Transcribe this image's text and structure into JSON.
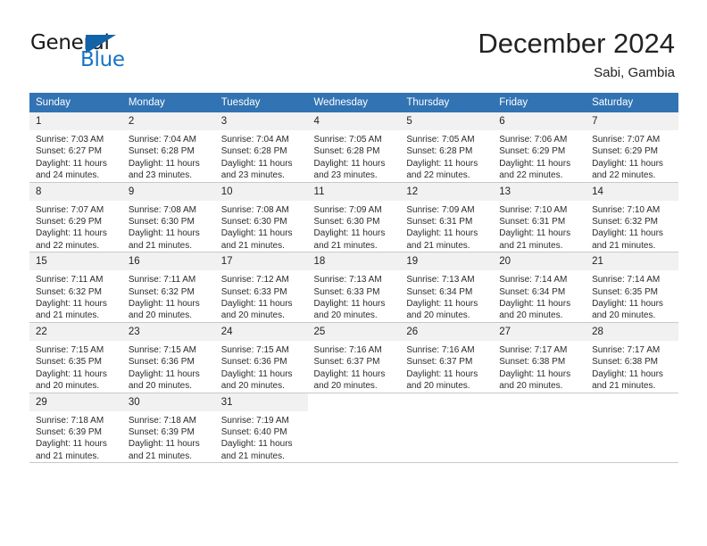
{
  "brand": {
    "name_part1": "General",
    "name_part2": "Blue",
    "triangle_color": "#1263a8",
    "blue_color": "#1673c6"
  },
  "header": {
    "title": "December 2024",
    "subtitle": "Sabi, Gambia",
    "header_bg_color": "#3273b3",
    "daynum_bg_color": "#f1f1f1"
  },
  "weekday_headers": [
    "Sunday",
    "Monday",
    "Tuesday",
    "Wednesday",
    "Thursday",
    "Friday",
    "Saturday"
  ],
  "weeks": [
    {
      "days": [
        {
          "num": "1",
          "sunrise": "Sunrise: 7:03 AM",
          "sunset": "Sunset: 6:27 PM",
          "daylight1": "Daylight: 11 hours",
          "daylight2": "and 24 minutes."
        },
        {
          "num": "2",
          "sunrise": "Sunrise: 7:04 AM",
          "sunset": "Sunset: 6:28 PM",
          "daylight1": "Daylight: 11 hours",
          "daylight2": "and 23 minutes."
        },
        {
          "num": "3",
          "sunrise": "Sunrise: 7:04 AM",
          "sunset": "Sunset: 6:28 PM",
          "daylight1": "Daylight: 11 hours",
          "daylight2": "and 23 minutes."
        },
        {
          "num": "4",
          "sunrise": "Sunrise: 7:05 AM",
          "sunset": "Sunset: 6:28 PM",
          "daylight1": "Daylight: 11 hours",
          "daylight2": "and 23 minutes."
        },
        {
          "num": "5",
          "sunrise": "Sunrise: 7:05 AM",
          "sunset": "Sunset: 6:28 PM",
          "daylight1": "Daylight: 11 hours",
          "daylight2": "and 22 minutes."
        },
        {
          "num": "6",
          "sunrise": "Sunrise: 7:06 AM",
          "sunset": "Sunset: 6:29 PM",
          "daylight1": "Daylight: 11 hours",
          "daylight2": "and 22 minutes."
        },
        {
          "num": "7",
          "sunrise": "Sunrise: 7:07 AM",
          "sunset": "Sunset: 6:29 PM",
          "daylight1": "Daylight: 11 hours",
          "daylight2": "and 22 minutes."
        }
      ]
    },
    {
      "days": [
        {
          "num": "8",
          "sunrise": "Sunrise: 7:07 AM",
          "sunset": "Sunset: 6:29 PM",
          "daylight1": "Daylight: 11 hours",
          "daylight2": "and 22 minutes."
        },
        {
          "num": "9",
          "sunrise": "Sunrise: 7:08 AM",
          "sunset": "Sunset: 6:30 PM",
          "daylight1": "Daylight: 11 hours",
          "daylight2": "and 21 minutes."
        },
        {
          "num": "10",
          "sunrise": "Sunrise: 7:08 AM",
          "sunset": "Sunset: 6:30 PM",
          "daylight1": "Daylight: 11 hours",
          "daylight2": "and 21 minutes."
        },
        {
          "num": "11",
          "sunrise": "Sunrise: 7:09 AM",
          "sunset": "Sunset: 6:30 PM",
          "daylight1": "Daylight: 11 hours",
          "daylight2": "and 21 minutes."
        },
        {
          "num": "12",
          "sunrise": "Sunrise: 7:09 AM",
          "sunset": "Sunset: 6:31 PM",
          "daylight1": "Daylight: 11 hours",
          "daylight2": "and 21 minutes."
        },
        {
          "num": "13",
          "sunrise": "Sunrise: 7:10 AM",
          "sunset": "Sunset: 6:31 PM",
          "daylight1": "Daylight: 11 hours",
          "daylight2": "and 21 minutes."
        },
        {
          "num": "14",
          "sunrise": "Sunrise: 7:10 AM",
          "sunset": "Sunset: 6:32 PM",
          "daylight1": "Daylight: 11 hours",
          "daylight2": "and 21 minutes."
        }
      ]
    },
    {
      "days": [
        {
          "num": "15",
          "sunrise": "Sunrise: 7:11 AM",
          "sunset": "Sunset: 6:32 PM",
          "daylight1": "Daylight: 11 hours",
          "daylight2": "and 21 minutes."
        },
        {
          "num": "16",
          "sunrise": "Sunrise: 7:11 AM",
          "sunset": "Sunset: 6:32 PM",
          "daylight1": "Daylight: 11 hours",
          "daylight2": "and 20 minutes."
        },
        {
          "num": "17",
          "sunrise": "Sunrise: 7:12 AM",
          "sunset": "Sunset: 6:33 PM",
          "daylight1": "Daylight: 11 hours",
          "daylight2": "and 20 minutes."
        },
        {
          "num": "18",
          "sunrise": "Sunrise: 7:13 AM",
          "sunset": "Sunset: 6:33 PM",
          "daylight1": "Daylight: 11 hours",
          "daylight2": "and 20 minutes."
        },
        {
          "num": "19",
          "sunrise": "Sunrise: 7:13 AM",
          "sunset": "Sunset: 6:34 PM",
          "daylight1": "Daylight: 11 hours",
          "daylight2": "and 20 minutes."
        },
        {
          "num": "20",
          "sunrise": "Sunrise: 7:14 AM",
          "sunset": "Sunset: 6:34 PM",
          "daylight1": "Daylight: 11 hours",
          "daylight2": "and 20 minutes."
        },
        {
          "num": "21",
          "sunrise": "Sunrise: 7:14 AM",
          "sunset": "Sunset: 6:35 PM",
          "daylight1": "Daylight: 11 hours",
          "daylight2": "and 20 minutes."
        }
      ]
    },
    {
      "days": [
        {
          "num": "22",
          "sunrise": "Sunrise: 7:15 AM",
          "sunset": "Sunset: 6:35 PM",
          "daylight1": "Daylight: 11 hours",
          "daylight2": "and 20 minutes."
        },
        {
          "num": "23",
          "sunrise": "Sunrise: 7:15 AM",
          "sunset": "Sunset: 6:36 PM",
          "daylight1": "Daylight: 11 hours",
          "daylight2": "and 20 minutes."
        },
        {
          "num": "24",
          "sunrise": "Sunrise: 7:15 AM",
          "sunset": "Sunset: 6:36 PM",
          "daylight1": "Daylight: 11 hours",
          "daylight2": "and 20 minutes."
        },
        {
          "num": "25",
          "sunrise": "Sunrise: 7:16 AM",
          "sunset": "Sunset: 6:37 PM",
          "daylight1": "Daylight: 11 hours",
          "daylight2": "and 20 minutes."
        },
        {
          "num": "26",
          "sunrise": "Sunrise: 7:16 AM",
          "sunset": "Sunset: 6:37 PM",
          "daylight1": "Daylight: 11 hours",
          "daylight2": "and 20 minutes."
        },
        {
          "num": "27",
          "sunrise": "Sunrise: 7:17 AM",
          "sunset": "Sunset: 6:38 PM",
          "daylight1": "Daylight: 11 hours",
          "daylight2": "and 20 minutes."
        },
        {
          "num": "28",
          "sunrise": "Sunrise: 7:17 AM",
          "sunset": "Sunset: 6:38 PM",
          "daylight1": "Daylight: 11 hours",
          "daylight2": "and 21 minutes."
        }
      ]
    },
    {
      "days": [
        {
          "num": "29",
          "sunrise": "Sunrise: 7:18 AM",
          "sunset": "Sunset: 6:39 PM",
          "daylight1": "Daylight: 11 hours",
          "daylight2": "and 21 minutes."
        },
        {
          "num": "30",
          "sunrise": "Sunrise: 7:18 AM",
          "sunset": "Sunset: 6:39 PM",
          "daylight1": "Daylight: 11 hours",
          "daylight2": "and 21 minutes."
        },
        {
          "num": "31",
          "sunrise": "Sunrise: 7:19 AM",
          "sunset": "Sunset: 6:40 PM",
          "daylight1": "Daylight: 11 hours",
          "daylight2": "and 21 minutes."
        },
        {
          "num": "",
          "sunrise": "",
          "sunset": "",
          "daylight1": "",
          "daylight2": "",
          "blank": true
        },
        {
          "num": "",
          "sunrise": "",
          "sunset": "",
          "daylight1": "",
          "daylight2": "",
          "blank": true
        },
        {
          "num": "",
          "sunrise": "",
          "sunset": "",
          "daylight1": "",
          "daylight2": "",
          "blank": true
        },
        {
          "num": "",
          "sunrise": "",
          "sunset": "",
          "daylight1": "",
          "daylight2": "",
          "blank": true
        }
      ]
    }
  ]
}
